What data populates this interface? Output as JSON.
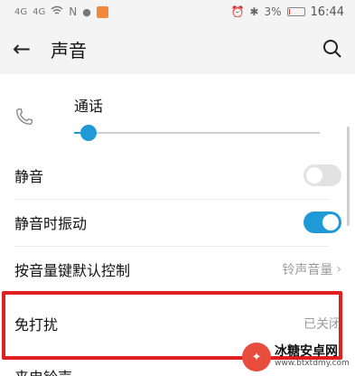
{
  "status_bar": {
    "signal_1": "4G",
    "signal_2": "4G",
    "battery_text": "3%",
    "time": "16:44",
    "battery_level": 0.03
  },
  "header": {
    "title": "声音"
  },
  "call_volume": {
    "label": "通话",
    "level": 0.06
  },
  "settings": [
    {
      "label": "静音",
      "toggle": "off"
    },
    {
      "label": "静音时振动",
      "toggle": "on"
    },
    {
      "label": "按音量键默认控制",
      "value": "铃声音量"
    },
    {
      "label": "免打扰",
      "value": "已关闭"
    }
  ],
  "bottom_partial": "来电铃声",
  "watermark": {
    "main": "冰糖安卓网",
    "sub": "www.btxtdmy.com"
  },
  "colors": {
    "accent": "#1f9ad6",
    "highlight": "#e02020"
  }
}
